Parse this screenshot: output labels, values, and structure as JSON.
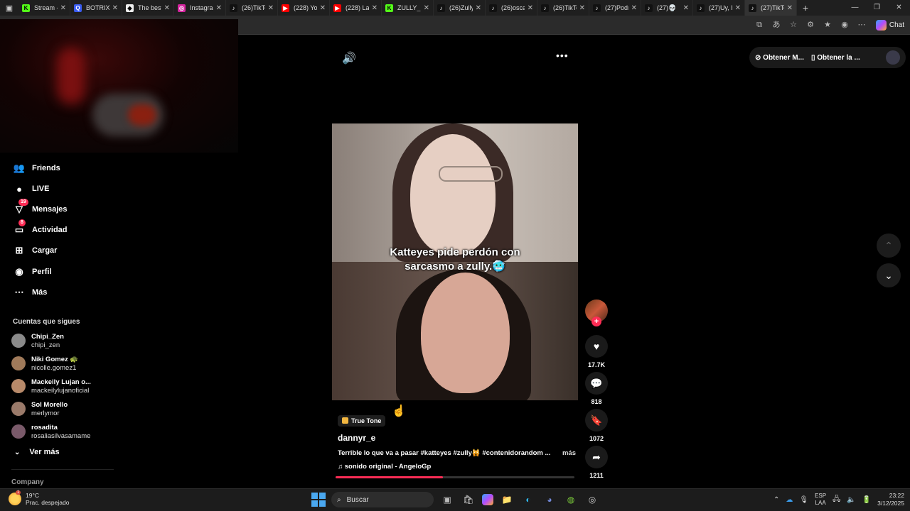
{
  "browser": {
    "tabs": [
      {
        "label": "Stream -",
        "icon": "K",
        "color": "#53fc18",
        "text": "#000"
      },
      {
        "label": "BOTRIX",
        "icon": "Q",
        "color": "#3a5cf0",
        "text": "#fff"
      },
      {
        "label": "The best",
        "icon": "◆",
        "color": "#eee",
        "text": "#000"
      },
      {
        "label": "Instagram",
        "icon": "◎",
        "color": "#d6249f",
        "text": "#fff"
      },
      {
        "label": "(26)TikTo",
        "icon": "♪",
        "color": "#111",
        "text": "#fff"
      },
      {
        "label": "(228) You",
        "icon": "▶",
        "color": "#f00",
        "text": "#fff"
      },
      {
        "label": "(228) La",
        "icon": "▶",
        "color": "#f00",
        "text": "#fff"
      },
      {
        "label": "ZULLY_",
        "icon": "K",
        "color": "#53fc18",
        "text": "#000"
      },
      {
        "label": "(26)Zully",
        "icon": "♪",
        "color": "#111",
        "text": "#fff"
      },
      {
        "label": "(26)oscar",
        "icon": "♪",
        "color": "#111",
        "text": "#fff"
      },
      {
        "label": "(26)TikTo",
        "icon": "♪",
        "color": "#111",
        "text": "#fff"
      },
      {
        "label": "(27)Podr",
        "icon": "♪",
        "color": "#111",
        "text": "#fff"
      },
      {
        "label": "(27)💀",
        "icon": "♪",
        "color": "#111",
        "text": "#fff"
      },
      {
        "label": "(27)Uy, E",
        "icon": "♪",
        "color": "#111",
        "text": "#fff"
      },
      {
        "label": "(27)TikTo",
        "icon": "♪",
        "color": "#111",
        "text": "#fff"
      }
    ],
    "copilot_label": "Chat"
  },
  "sidebar": {
    "nav": [
      {
        "label": "Friends",
        "icon": "👥",
        "badge": ""
      },
      {
        "label": "LIVE",
        "icon": "●",
        "badge": ""
      },
      {
        "label": "Mensajes",
        "icon": "▽",
        "badge": "19"
      },
      {
        "label": "Actividad",
        "icon": "▭",
        "badge": "8"
      },
      {
        "label": "Cargar",
        "icon": "⊞",
        "badge": ""
      },
      {
        "label": "Perfil",
        "icon": "◉",
        "badge": ""
      },
      {
        "label": "Más",
        "icon": "⋯",
        "badge": ""
      }
    ],
    "following_title": "Cuentas que sigues",
    "following": [
      {
        "name": "Chipi_Zen",
        "handle": "chipi_zen",
        "color": "#8a8a8a"
      },
      {
        "name": "Niki Gomez 🐢",
        "handle": "nicolle.gomez1",
        "color": "#a07a5a"
      },
      {
        "name": "Mackeily Lujan o...",
        "handle": "mackeilylujanoficial",
        "color": "#b88a6a"
      },
      {
        "name": "Sol Morello",
        "handle": "merlymor",
        "color": "#9a7a6a"
      },
      {
        "name": "rosadita",
        "handle": "rosaliasilvasamame",
        "color": "#7a5a6a"
      }
    ],
    "see_more": "Ver más",
    "company": "Company"
  },
  "promo": {
    "item1": "Obtener M...",
    "item2": "Obtener la ..."
  },
  "video": {
    "caption_line1": "Katteyes pide perdón con",
    "caption_line2": "sarcasmo a zully.🥶",
    "likes": "17.7K",
    "comments": "818",
    "saves": "1072",
    "shares": "1211",
    "effect": "True Tone",
    "username": "dannyr_e",
    "description": "Terrible lo que va a pasar #katteyes #zully🙀 #contenidorandom ...",
    "more": "más",
    "sound": "sonido original - AngeloGp",
    "progress": 0.45
  },
  "taskbar": {
    "temp": "19°C",
    "weather": "Prac. despejado",
    "weather_badge": "1",
    "search_placeholder": "Buscar",
    "lang1": "ESP",
    "lang2": "LAA",
    "time": "23:22",
    "date": "3/12/2025"
  }
}
